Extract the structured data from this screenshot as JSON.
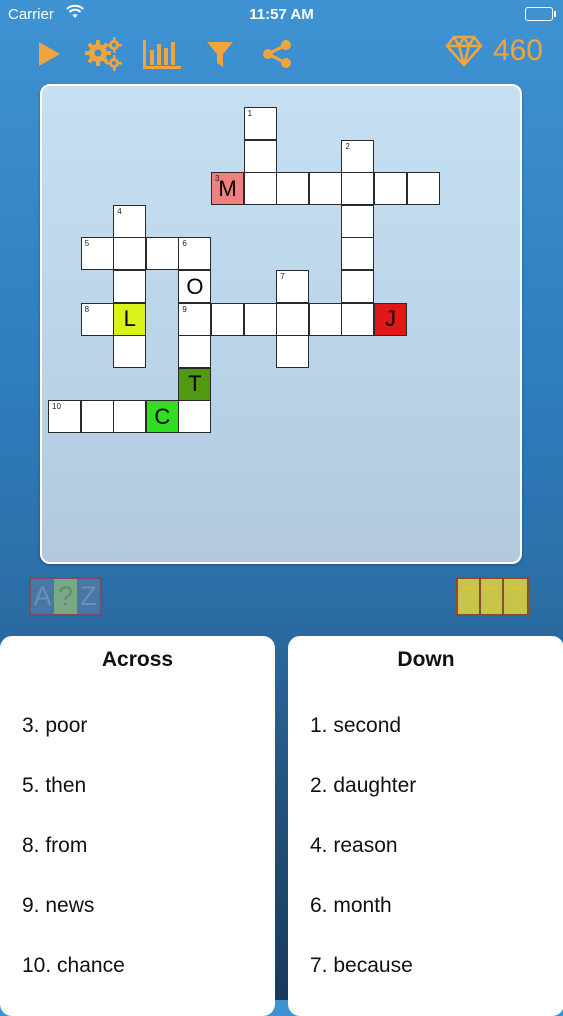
{
  "status": {
    "carrier": "Carrier",
    "time": "11:57 AM"
  },
  "toolbar": {
    "buttons": [
      "play-icon",
      "settings-gears-icon",
      "stats-bars-icon",
      "filter-funnel-icon",
      "share-icon"
    ],
    "accent": "#f2a43c",
    "gems": "460"
  },
  "grid": {
    "cells": [
      {
        "r": 0,
        "c": 6,
        "n": "1"
      },
      {
        "r": 1,
        "c": 6
      },
      {
        "r": 1,
        "c": 9,
        "n": "2"
      },
      {
        "r": 2,
        "c": 5,
        "n": "3",
        "l": "M",
        "bg": "#f08080"
      },
      {
        "r": 2,
        "c": 6
      },
      {
        "r": 2,
        "c": 7
      },
      {
        "r": 2,
        "c": 8
      },
      {
        "r": 2,
        "c": 9
      },
      {
        "r": 2,
        "c": 10
      },
      {
        "r": 2,
        "c": 11
      },
      {
        "r": 3,
        "c": 2,
        "n": "4"
      },
      {
        "r": 3,
        "c": 9
      },
      {
        "r": 4,
        "c": 1,
        "n": "5"
      },
      {
        "r": 4,
        "c": 2
      },
      {
        "r": 4,
        "c": 3
      },
      {
        "r": 4,
        "c": 4,
        "n": "6"
      },
      {
        "r": 4,
        "c": 9
      },
      {
        "r": 5,
        "c": 2
      },
      {
        "r": 5,
        "c": 4,
        "l": "O"
      },
      {
        "r": 5,
        "c": 7,
        "n": "7"
      },
      {
        "r": 5,
        "c": 9
      },
      {
        "r": 6,
        "c": 1,
        "n": "8"
      },
      {
        "r": 6,
        "c": 2,
        "l": "L",
        "bg": "#d9f21a"
      },
      {
        "r": 6,
        "c": 4,
        "n": "9"
      },
      {
        "r": 6,
        "c": 5
      },
      {
        "r": 6,
        "c": 6
      },
      {
        "r": 6,
        "c": 7
      },
      {
        "r": 6,
        "c": 8
      },
      {
        "r": 6,
        "c": 9
      },
      {
        "r": 6,
        "c": 10,
        "l": "J",
        "bg": "#e01818"
      },
      {
        "r": 7,
        "c": 2
      },
      {
        "r": 7,
        "c": 4
      },
      {
        "r": 7,
        "c": 7
      },
      {
        "r": 8,
        "c": 4,
        "l": "T",
        "bg": "#4f9a12"
      },
      {
        "r": 9,
        "c": 0,
        "n": "10"
      },
      {
        "r": 9,
        "c": 1
      },
      {
        "r": 9,
        "c": 2
      },
      {
        "r": 9,
        "c": 3,
        "l": "C",
        "bg": "#33dd22"
      },
      {
        "r": 9,
        "c": 4
      }
    ]
  },
  "hints": {
    "az": [
      "A",
      "?",
      "Z"
    ],
    "qq": [
      "?",
      "?",
      "?"
    ]
  },
  "across": {
    "title": "Across",
    "clues": [
      "3. poor",
      "5. then",
      "8. from",
      "9. news",
      "10. chance"
    ]
  },
  "down": {
    "title": "Down",
    "clues": [
      "1. second",
      "2. daughter",
      "4. reason",
      "6. month",
      "7. because"
    ]
  }
}
